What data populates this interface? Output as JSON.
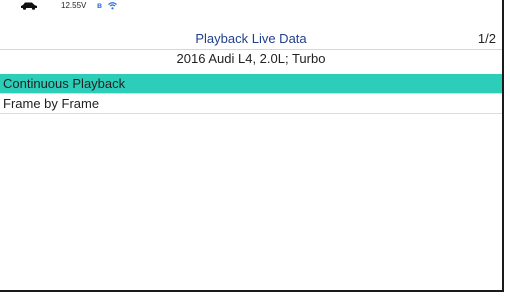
{
  "status_bar": {
    "vehicle_icon": "car-icon",
    "voltage": "12.55V",
    "bluetooth_icon": "bluetooth-icon",
    "wifi_icon": "wifi-icon"
  },
  "header": {
    "title": "Playback Live Data",
    "page_indicator": "1/2",
    "vehicle": "2016 Audi L4, 2.0L; Turbo",
    "title_color": "#1f3f8f"
  },
  "menu": {
    "selected_color": "#2ccdb9",
    "items": [
      {
        "label": "Continuous Playback",
        "selected": true
      },
      {
        "label": "Frame by Frame",
        "selected": false
      }
    ]
  }
}
